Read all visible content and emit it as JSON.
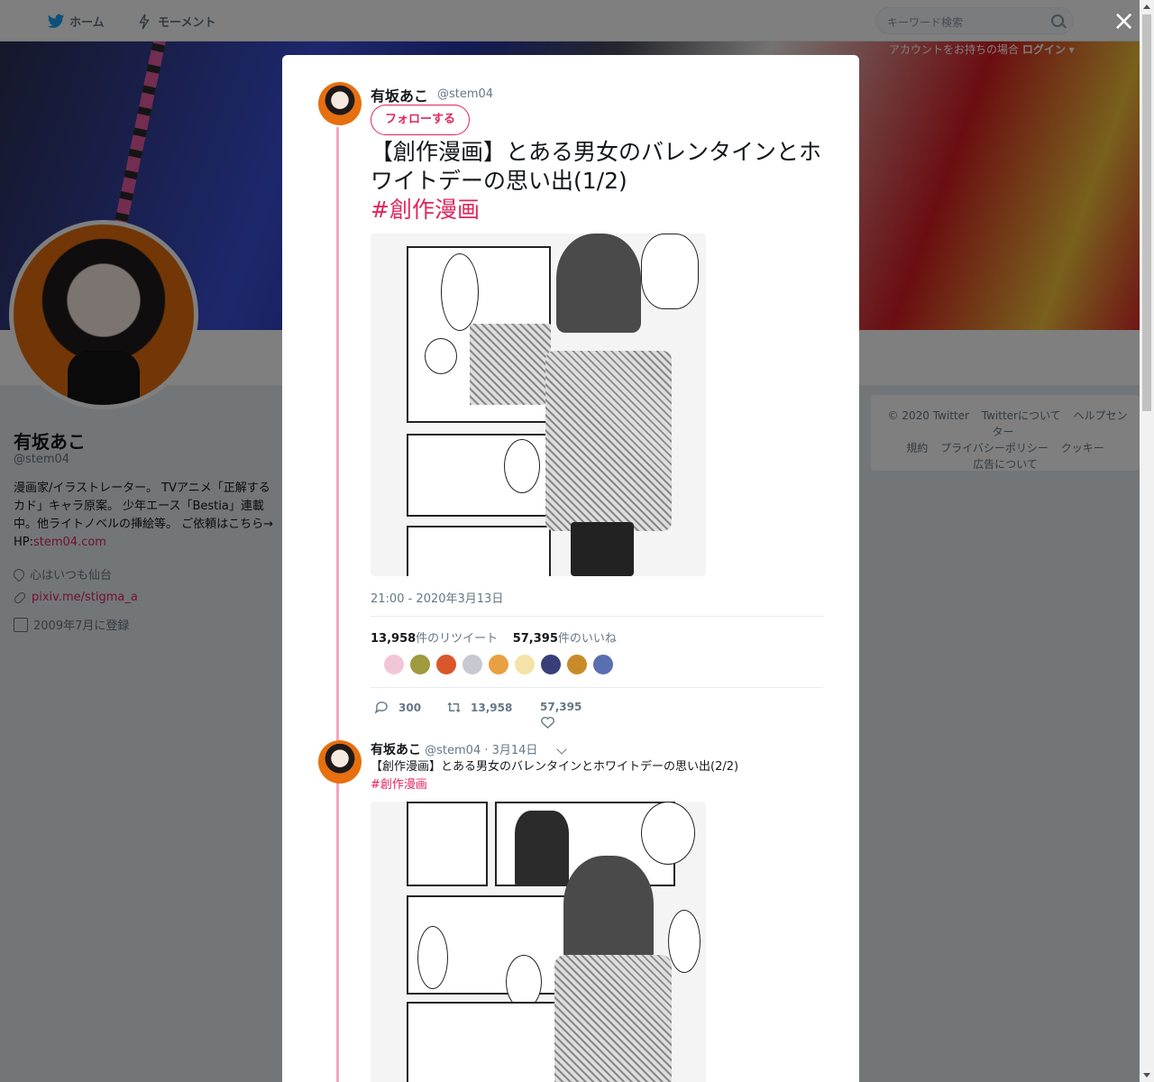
{
  "nav": {
    "home_label": "ホーム",
    "moments_label": "モーメント",
    "search_placeholder": "キーワード検索",
    "login_hint": "アカウントをお持ちの場合",
    "login_label": "ログイン"
  },
  "profile": {
    "name": "有坂あこ",
    "handle": "@stem04",
    "bio": "漫画家/イラストレーター。 TVアニメ「正解するカド」キャラ原案。 少年エース「Bestia」連載中。他ライトノベルの挿絵等。 ご依頼はこちら→ HP:",
    "bio_link": "stem04.com",
    "location": "心はいつも仙台",
    "website": "pixiv.me/stigma_a",
    "joined": "2009年7月に登録"
  },
  "footer": {
    "copyright": "© 2020 Twitter",
    "about": "Twitterについて",
    "help": "ヘルプセンター",
    "terms": "規約",
    "privacy": "プライバシーポリシー",
    "cookies": "クッキー",
    "ads": "広告について"
  },
  "modal": {
    "close_label": "×",
    "tweet": {
      "name": "有坂あこ",
      "handle": "@stem04",
      "follow_label": "フォローする",
      "text": "【創作漫画】とある男女のバレンタインとホワイトデーの思い出(1/2)",
      "hashtag": "#創作漫画",
      "timestamp": "21:00 - 2020年3月13日",
      "retweet_count": "13,958",
      "retweet_label": "件のリツイート",
      "like_count": "57,395",
      "like_label": "件のいいね",
      "reply_action": "300",
      "retweet_action": "13,958",
      "like_action": "57,395"
    },
    "reply": {
      "name": "有坂あこ",
      "handle": "@stem04",
      "date": "· 3月14日",
      "text": "【創作漫画】とある男女のバレンタインとホワイトデーの思い出(2/2)",
      "hashtag": "#創作漫画"
    }
  },
  "colors": {
    "accent": "#e0245e",
    "thread": "#f5a5bf",
    "muted": "#657786"
  },
  "likers": [
    "#f2c6d9",
    "#9e9a3d",
    "#d9572b",
    "#c8c8d0",
    "#e9a040",
    "#f3e3a8",
    "#3a3f7a",
    "#c98b2a",
    "#5a6fb0"
  ]
}
